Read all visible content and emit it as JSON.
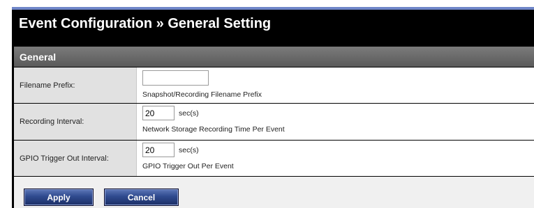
{
  "header": {
    "title": "Event Configuration » General Setting"
  },
  "section": {
    "title": "General"
  },
  "fields": {
    "filename_prefix": {
      "label": "Filename Prefix:",
      "value": "",
      "hint": "Snapshot/Recording Filename Prefix"
    },
    "recording_interval": {
      "label": "Recording Interval:",
      "value": "20",
      "unit": "sec(s)",
      "hint": "Network Storage Recording Time Per Event"
    },
    "gpio_interval": {
      "label": "GPIO Trigger Out Interval:",
      "value": "20",
      "unit": "sec(s)",
      "hint": "GPIO Trigger Out Per Event"
    }
  },
  "buttons": {
    "apply": "Apply",
    "cancel": "Cancel"
  },
  "colors": {
    "frame": "#000000",
    "section_header": "#6b6b6b",
    "label_cell": "#e1e1e1",
    "button": "#2f4a8e",
    "top_strip": "#6f86c8"
  }
}
